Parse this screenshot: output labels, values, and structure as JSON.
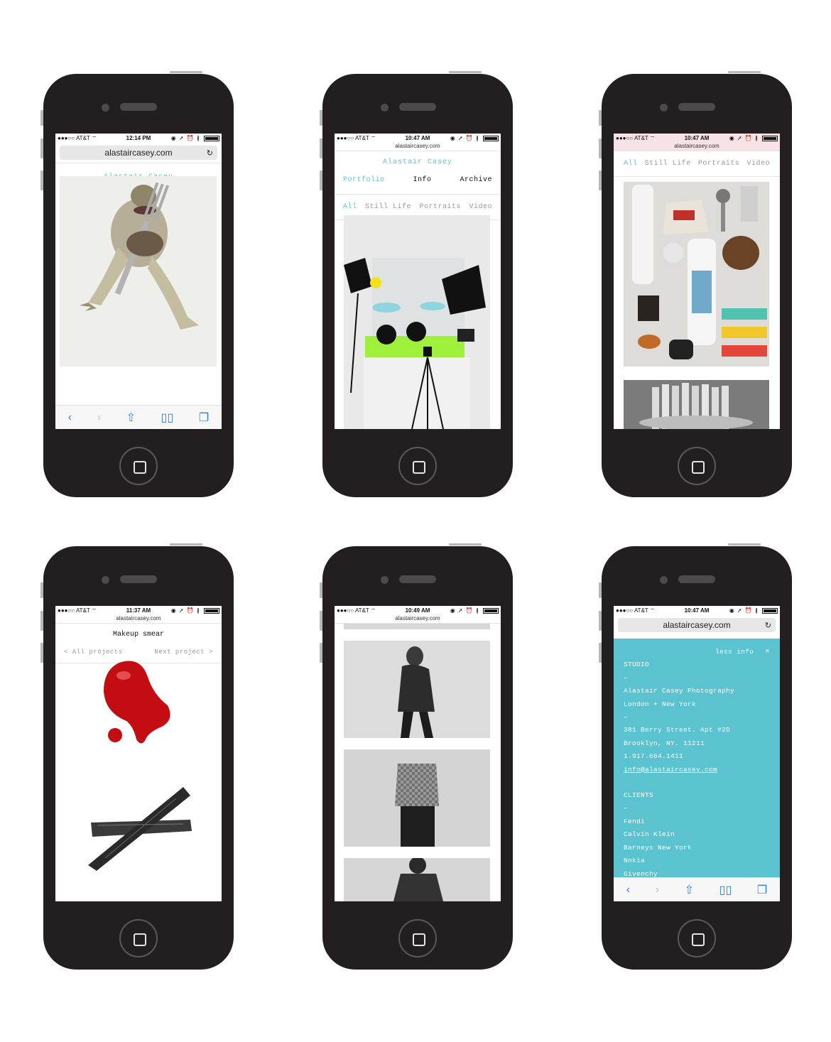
{
  "colors": {
    "phone_body": "#231f20",
    "accent_teal": "#5ac4cf",
    "ios_blue": "#2e7ee6",
    "overlay_teal": "#5bc2cf"
  },
  "status": {
    "carrier": "●●●○○ AT&T ⌔",
    "indicators": "◉ ➚ ⏰ ∦",
    "times": [
      "12:14 PM",
      "10:47 AM",
      "10:47 AM",
      "11:37 AM",
      "10:49 AM",
      "10:47 AM"
    ]
  },
  "browser": {
    "url": "alastaircasey.com",
    "reload_icon": "reload-icon"
  },
  "toolbar_icons": [
    "back-icon",
    "forward-icon",
    "share-icon",
    "bookmarks-icon",
    "tabs-icon"
  ],
  "site": {
    "title": "Alastair Casey",
    "nav": {
      "portfolio": "Portfolio",
      "info": "Info",
      "archive": "Archive"
    },
    "filters": {
      "all": "All",
      "still_life": "Still Life",
      "portraits": "Portraits",
      "video": "Video"
    }
  },
  "project": {
    "title": "Makeup smear",
    "prev": "< All projects",
    "next": "Next project >"
  },
  "info_panel": {
    "close_label": "less info",
    "close_icon": "×",
    "studio_heading": "STUDIO",
    "dash": "–",
    "studio_name": "Alastair Casey Photography",
    "studio_locations": "London + New York",
    "address_1": "381 Berry Street. Apt #2D",
    "address_2": "Brooklyn, NY. 11211",
    "phone": "1.917.664.1411",
    "email": "info@alastaircasey.com",
    "clients_heading": "CLIENTS",
    "clients": [
      "Fendi",
      "Calvin Klein",
      "Barneys New York",
      "Nokia",
      "Givenchy"
    ]
  }
}
